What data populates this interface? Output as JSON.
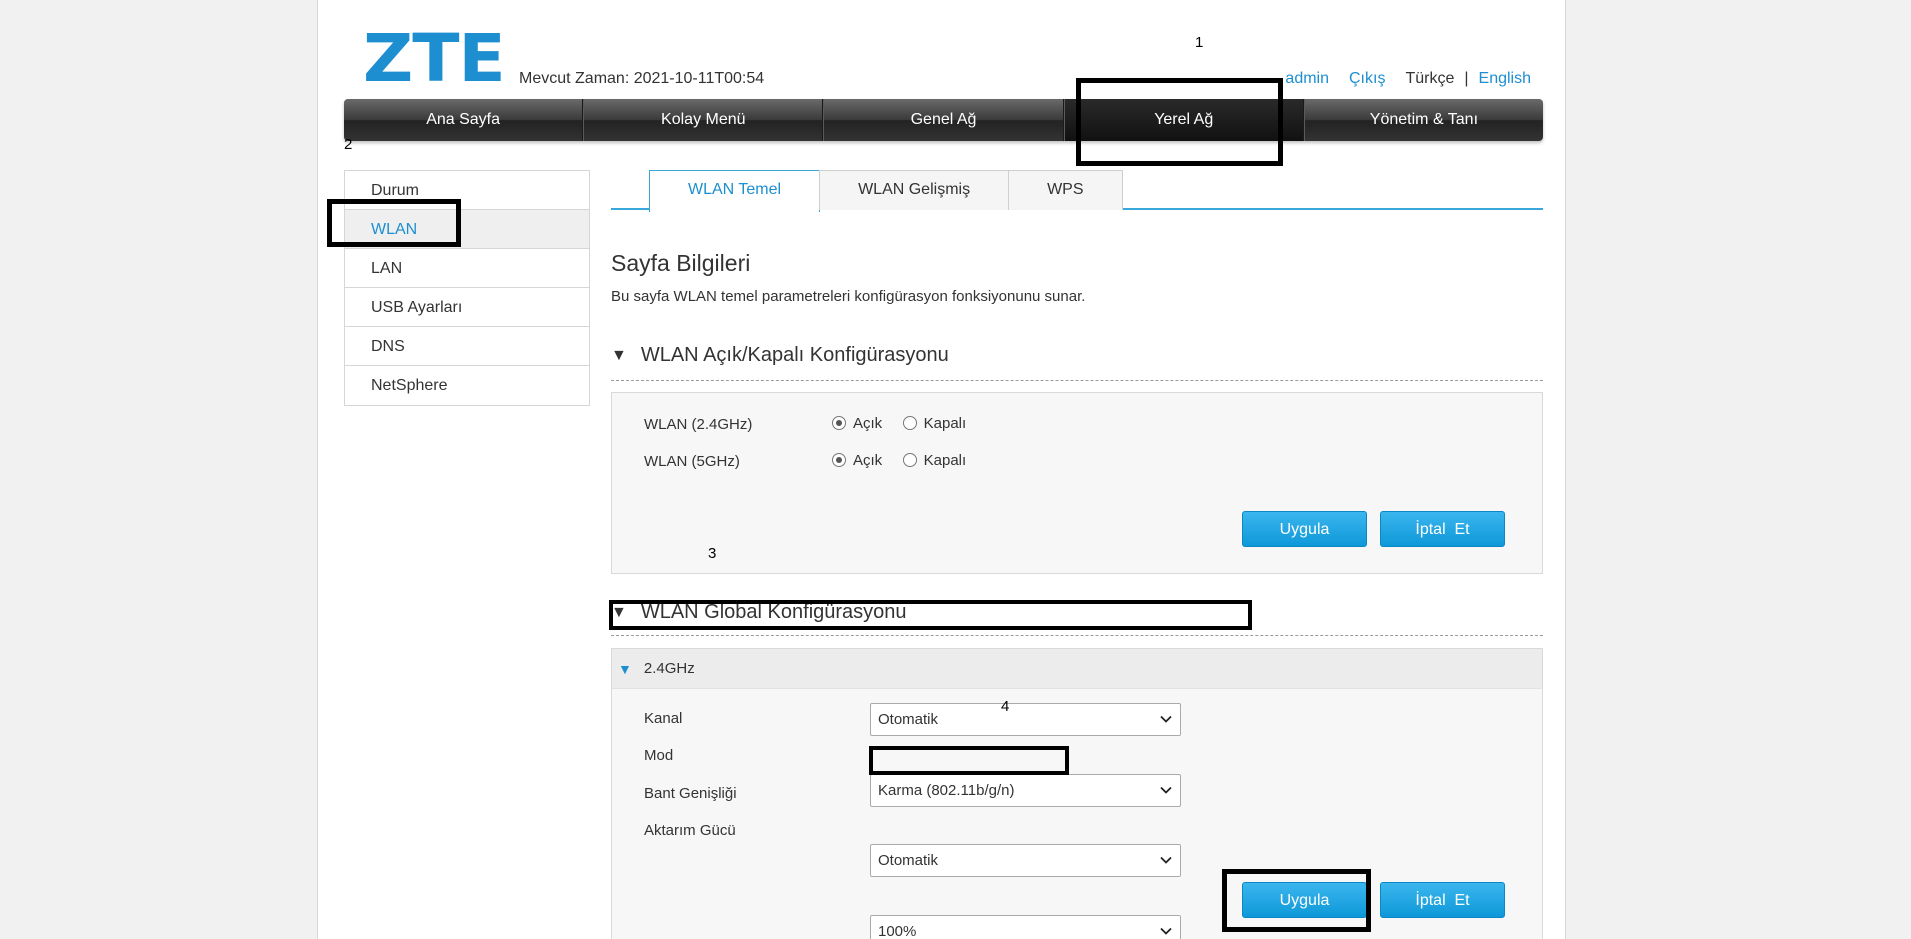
{
  "header": {
    "logo_text": "ZTE",
    "time_label": "Mevcut Zaman: 2021-10-11T00:54",
    "user": "admin",
    "logout": "Çıkış",
    "lang_tr": "Türkçe",
    "lang_sep": "|",
    "lang_en": "English"
  },
  "nav": {
    "items": [
      "Ana Sayfa",
      "Kolay Menü",
      "Genel Ağ",
      "Yerel Ağ",
      "Yönetim & Tanı"
    ],
    "active": "Yerel Ağ"
  },
  "sidebar": {
    "items": [
      "Durum",
      "WLAN",
      "LAN",
      "USB Ayarları",
      "DNS",
      "NetSphere"
    ],
    "active": "WLAN"
  },
  "tabs": {
    "items": [
      "WLAN Temel",
      "WLAN Gelişmiş",
      "WPS"
    ],
    "active": "WLAN Temel"
  },
  "info": {
    "title": "Sayfa Bilgileri",
    "description": "Bu sayfa WLAN temel parametreleri konfigürasyon fonksiyonunu sunar."
  },
  "onoff": {
    "title": "WLAN Açık/Kapalı Konfigürasyonu",
    "rows": [
      {
        "label": "WLAN (2.4GHz)",
        "on": "Açık",
        "off": "Kapalı",
        "selected": "on"
      },
      {
        "label": "WLAN (5GHz)",
        "on": "Açık",
        "off": "Kapalı",
        "selected": "on"
      }
    ],
    "apply": "Uygula",
    "cancel": "İptal  Et"
  },
  "global": {
    "title": "WLAN Global Konfigürasyonu",
    "band": "2.4GHz",
    "fields": [
      {
        "label": "Kanal",
        "value": "Otomatik"
      },
      {
        "label": "Mod",
        "value": "Karma (802.11b/g/n)"
      },
      {
        "label": "Bant Genişliği",
        "value": "Otomatik"
      },
      {
        "label": "Aktarım Gücü",
        "value": "100%"
      }
    ],
    "apply": "Uygula",
    "cancel": "İptal  Et"
  },
  "annotations": [
    "1",
    "2",
    "3",
    "4"
  ],
  "icons": {
    "section_toggle": "triangle-down-icon",
    "band_toggle": "triangle-down-icon",
    "select_arrow": "chevron-down-icon"
  },
  "colors": {
    "accent": "#1d8fd0",
    "button": "#12a0e0",
    "nav_dark": "#333333"
  }
}
